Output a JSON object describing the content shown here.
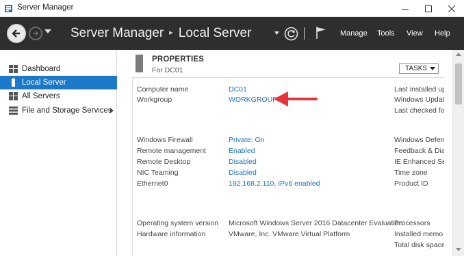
{
  "window": {
    "title": "Server Manager",
    "controls": {
      "minimize": "—",
      "maximize": "☐",
      "close": "✕"
    }
  },
  "header": {
    "app_name": "Server Manager",
    "current_page": "Local Server",
    "menus": [
      "Manage",
      "Tools",
      "View",
      "Help"
    ]
  },
  "sidebar": {
    "items": [
      {
        "label": "Dashboard",
        "icon": "dashboard-icon"
      },
      {
        "label": "Local Server",
        "icon": "server-icon",
        "active": true
      },
      {
        "label": "All Servers",
        "icon": "servers-icon"
      },
      {
        "label": "File and Storage Services",
        "icon": "storage-icon",
        "has_submenu": true
      }
    ]
  },
  "properties": {
    "title": "PROPERTIES",
    "subtitle": "For DC01",
    "tasks_label": "TASKS",
    "rows": [
      {
        "label": "Computer name",
        "value": "DC01",
        "link": true
      },
      {
        "label": "Workgroup",
        "value": "WORKGROUP",
        "link": true
      },
      {
        "label": "Windows Firewall",
        "value": "Private: On",
        "link": true
      },
      {
        "label": "Remote management",
        "value": "Enabled",
        "link": true
      },
      {
        "label": "Remote Desktop",
        "value": "Disabled",
        "link": true
      },
      {
        "label": "NIC Teaming",
        "value": "Disabled",
        "link": true
      },
      {
        "label": "Ethernet0",
        "value": "192.168.2.110, IPv6 enabled",
        "link": true
      },
      {
        "label": "Operating system version",
        "value": "Microsoft Windows Server 2016 Datacenter Evaluation",
        "link": false
      },
      {
        "label": "Hardware information",
        "value": "VMware, Inc. VMware Virtual Platform",
        "link": false
      }
    ],
    "right_column": [
      "Last installed up",
      "Windows Updat",
      "Last checked fo",
      "Windows Defen",
      "Feedback & Dia",
      "IE Enhanced Se",
      "Time zone",
      "Product ID",
      "Processors",
      "Installed memo",
      "Total disk space"
    ]
  },
  "colors": {
    "header_bg": "#2e2e2e",
    "active_item_bg": "#1c79c9",
    "link": "#1d6fc0",
    "annotation_arrow": "#e8333a"
  }
}
